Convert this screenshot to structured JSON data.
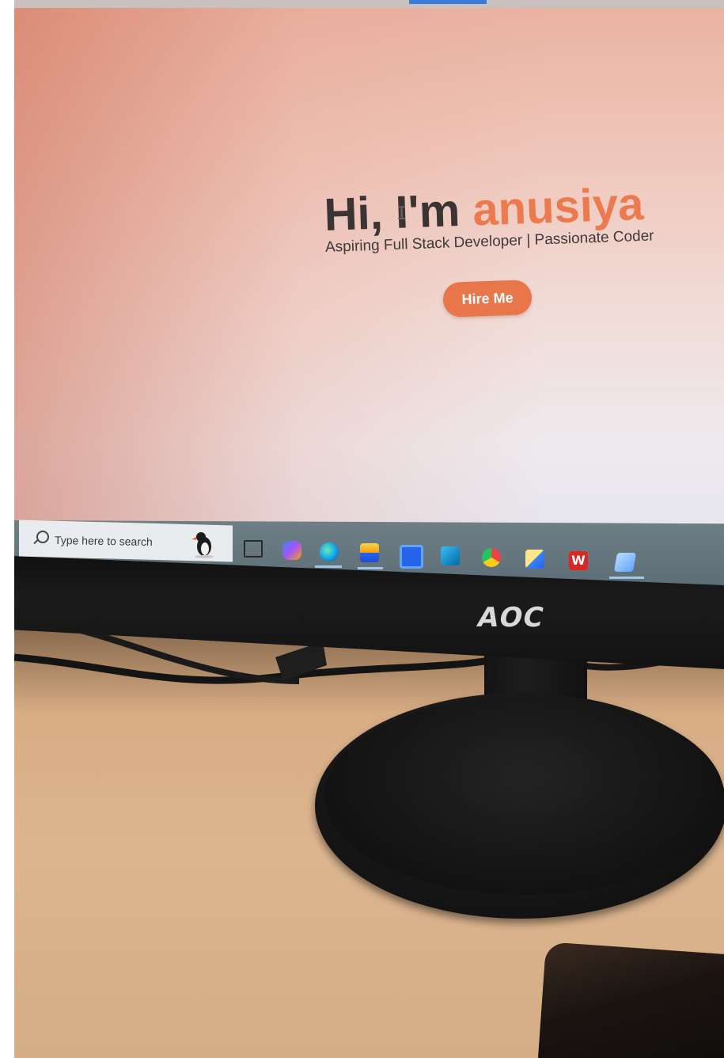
{
  "website": {
    "greeting": "Hi, I'm",
    "name": "anusiya",
    "subtitle": "Aspiring Full Stack Developer | Passionate Coder",
    "cta_label": "Hire Me",
    "colors": {
      "accent": "#ec7a4f",
      "button": "#e8764a",
      "heading": "#3b3435"
    }
  },
  "taskbar": {
    "search_placeholder": "Type here to search",
    "icons": [
      "search-icon",
      "puffin-icon",
      "task-view-icon",
      "copilot-icon",
      "edge-icon",
      "file-explorer-icon",
      "microsoft-store-icon",
      "outlook-icon",
      "chrome-icon",
      "python-idle-icon",
      "wps-office-icon",
      "notepad-icon"
    ]
  },
  "monitor": {
    "brand": "AOC"
  }
}
